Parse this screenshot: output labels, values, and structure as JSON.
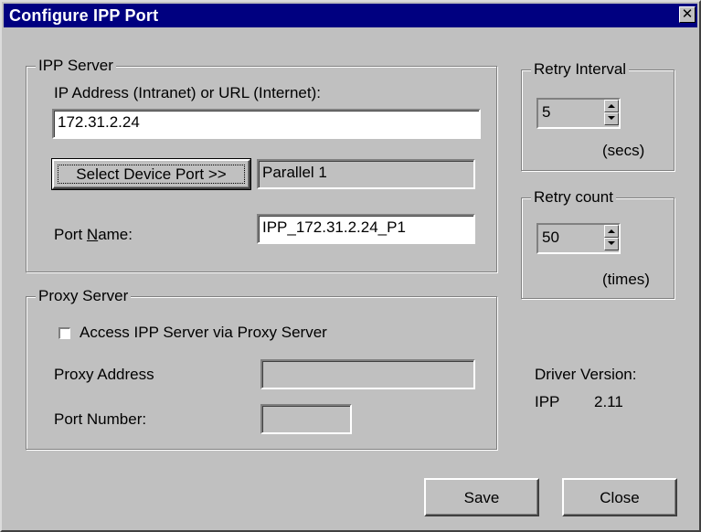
{
  "window": {
    "title": "Configure IPP Port",
    "close_glyph": "✕"
  },
  "ipp_server": {
    "legend": "IPP Server",
    "address_label": "IP Address (Intranet) or URL (Internet):",
    "address_value": "172.31.2.24",
    "select_port_button": "Select Device Port >>",
    "device_port_value": "Parallel 1",
    "port_name_label_pre": "Port ",
    "port_name_label_accel": "N",
    "port_name_label_post": "ame:",
    "port_name_value": "IPP_172.31.2.24_P1"
  },
  "proxy_server": {
    "legend": "Proxy Server",
    "checkbox_label": "Access IPP Server via Proxy Server",
    "checkbox_checked": false,
    "proxy_address_label": "Proxy Address",
    "proxy_address_value": "",
    "port_number_label": "Port Number:",
    "port_number_value": ""
  },
  "retry_interval": {
    "legend": "Retry Interval",
    "value": "5",
    "unit": "(secs)"
  },
  "retry_count": {
    "legend": "Retry count",
    "value": "50",
    "unit": "(times)"
  },
  "driver": {
    "label": "Driver Version:",
    "name": "IPP",
    "version": "2.11"
  },
  "buttons": {
    "save": "Save",
    "close": "Close"
  },
  "icons": {
    "spin_up": "spin-up-arrow-icon",
    "spin_down": "spin-down-arrow-icon",
    "close": "close-icon"
  }
}
